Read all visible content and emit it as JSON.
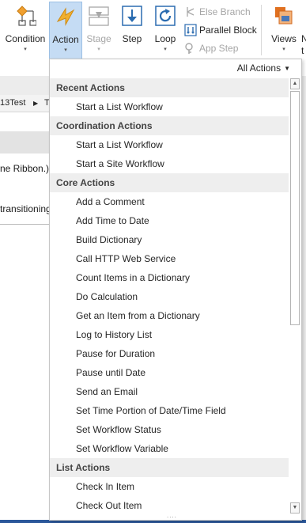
{
  "ribbon": {
    "condition_label": "Condition",
    "action_label": "Action",
    "stage_label": "Stage",
    "step_label": "Step",
    "loop_label": "Loop",
    "else_branch_label": "Else Branch",
    "parallel_block_label": "Parallel Block",
    "app_step_label": "App Step",
    "views_label": "Views",
    "cut_label_top": "N",
    "cut_label_mid": "t",
    "dropdown_glyph": "▾",
    "accent_color": "#c5dcf4"
  },
  "background": {
    "crumb_left": "13Test",
    "crumb_sep": "▶",
    "crumb_right": "T",
    "text_1": "ne Ribbon.)",
    "text_2": "transitioning"
  },
  "dropdown": {
    "filter_label": "All Actions",
    "filter_caret": "▼",
    "grip": "....",
    "sections": [
      {
        "title": "Recent Actions",
        "items": [
          "Start a List Workflow"
        ]
      },
      {
        "title": "Coordination Actions",
        "items": [
          "Start a List Workflow",
          "Start a Site Workflow"
        ]
      },
      {
        "title": "Core Actions",
        "items": [
          "Add a Comment",
          "Add Time to Date",
          "Build Dictionary",
          "Call HTTP Web Service",
          "Count Items in a Dictionary",
          "Do Calculation",
          "Get an Item from a Dictionary",
          "Log to History List",
          "Pause for Duration",
          "Pause until Date",
          "Send an Email",
          "Set Time Portion of Date/Time Field",
          "Set Workflow Status",
          "Set Workflow Variable"
        ]
      },
      {
        "title": "List Actions",
        "items": [
          "Check In Item",
          "Check Out Item"
        ]
      }
    ]
  }
}
